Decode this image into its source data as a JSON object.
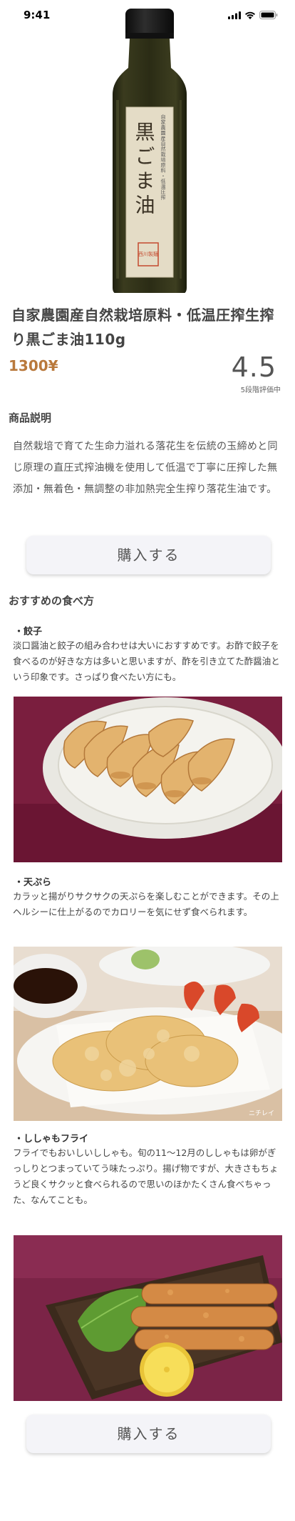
{
  "status_bar": {
    "time": "9:41",
    "icons": [
      "signal-icon",
      "wifi-icon",
      "battery-icon"
    ]
  },
  "product": {
    "image_label_main": "黒ごま油",
    "image_label_side": "自家農園産自然栽培原料・低温圧搾",
    "image_seal": "西川製麺",
    "title": "自家農園産自然栽培原料・低温圧搾生搾り黒ごま油110g",
    "price": "1300¥",
    "rating": "4.5",
    "rating_label": "5段階評価中"
  },
  "description": {
    "heading": "商品説明",
    "text": "自然栽培で育てた生命力溢れる落花生を伝統の玉締めと同じ原理の直圧式搾油機を使用して低温で丁寧に圧搾した無添加・無着色・無調整の非加熱完全生搾り落花生油です。"
  },
  "buy_button_label": "購入する",
  "recommend": {
    "heading": "おすすめの食べ方",
    "items": [
      {
        "title": "・餃子",
        "text": "淡口醤油と餃子の組み合わせは大いにおすすめです。お酢で餃子を食べるのが好きな方は多いと思いますが、酢を引き立てた酢醤油という印象です。さっぱり食べたい方にも。"
      },
      {
        "title": "・天ぷら",
        "text": "カラッと揚がりサクサクの天ぷらを楽しむことができます。その上ヘルシーに仕上がるのでカロリーを気にせず食べられます。",
        "photo_credit": "ニチレイ"
      },
      {
        "title": "・ししゃもフライ",
        "text": "フライでもおいしいししゃも。旬の11〜12月のししゃもは卵がぎっしりとつまっていてう味たっぷり。揚げ物ですが、大きさもちょうど良くサクッと食べられるので思いのほかたくさん食べちゃった、なんてことも。"
      }
    ]
  },
  "colors": {
    "price": "#b9793c",
    "button_bg": "#f4f4f8",
    "text": "#444444"
  }
}
